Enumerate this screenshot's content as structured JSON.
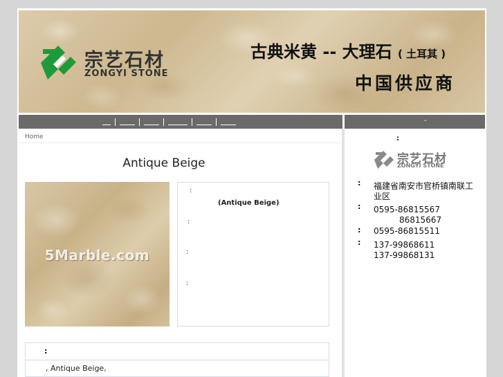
{
  "banner": {
    "brand_cn": "宗艺石材",
    "brand_en": "ZONGYI STONE",
    "title_main": "古典米黄 -- 大理石",
    "title_origin": "( 土耳其 )",
    "subtitle": "中国供应商"
  },
  "nav": {
    "items": [
      "",
      "",
      "",
      "",
      "",
      ""
    ],
    "side_label": "-"
  },
  "breadcrumb": {
    "home": "Home"
  },
  "product": {
    "title": "Antique Beige",
    "watermark": "5Marble.com",
    "spec_colon": ":",
    "spec_name": "(Antique Beige)"
  },
  "description": {
    "heading": ":",
    "text": ", Antique Beige,"
  },
  "sidebar": {
    "header_colon": ":",
    "logo_cn": "宗艺石材",
    "logo_en": "ZONGYI STONE",
    "contact": {
      "colon": ":",
      "address": "福建省南安市官桥镇南联工业区",
      "phone_1": "0595-86815567",
      "phone_2": "86815667",
      "fax": "0595-86815511",
      "mobile_1": "137-99868611",
      "mobile_2": "137-99868131"
    }
  },
  "colors": {
    "brand_green": "#1f9a3a",
    "nav_gray": "#6a6a6a",
    "page_bg": "#d6d6d6"
  }
}
